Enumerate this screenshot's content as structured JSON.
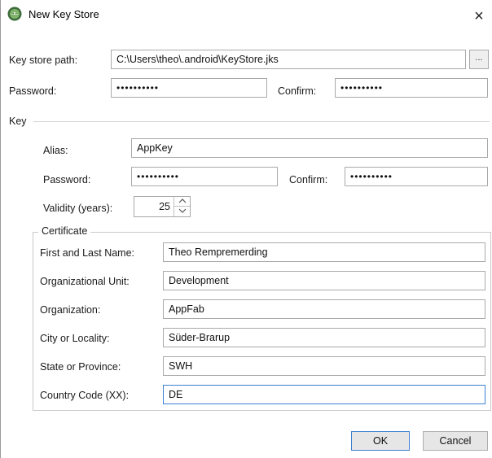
{
  "window": {
    "title": "New Key Store",
    "close_glyph": "×"
  },
  "keystore": {
    "path_label": "Key store path:",
    "path_value": "C:\\Users\\theo\\.android\\KeyStore.jks",
    "browse_label": "...",
    "password_label": "Password:",
    "password_value": "••••••••••",
    "confirm_label": "Confirm:",
    "confirm_value": "••••••••••"
  },
  "key": {
    "section_label": "Key",
    "alias_label": "Alias:",
    "alias_value": "AppKey",
    "password_label": "Password:",
    "password_value": "••••••••••",
    "confirm_label": "Confirm:",
    "confirm_value": "••••••••••",
    "validity_label": "Validity (years):",
    "validity_value": "25"
  },
  "certificate": {
    "section_label": "Certificate",
    "fields": [
      {
        "label": "First and Last Name:",
        "value": "Theo Rempremerding"
      },
      {
        "label": "Organizational Unit:",
        "value": "Development"
      },
      {
        "label": "Organization:",
        "value": "AppFab"
      },
      {
        "label": "City or Locality:",
        "value": "Süder-Brarup"
      },
      {
        "label": "State or Province:",
        "value": "SWH"
      },
      {
        "label": "Country Code (XX):",
        "value": "DE"
      }
    ]
  },
  "buttons": {
    "ok": "OK",
    "cancel": "Cancel"
  },
  "icons": {
    "app": "android-studio-icon",
    "close": "close-icon",
    "spin_up": "chevron-up-icon",
    "spin_down": "chevron-down-icon"
  }
}
